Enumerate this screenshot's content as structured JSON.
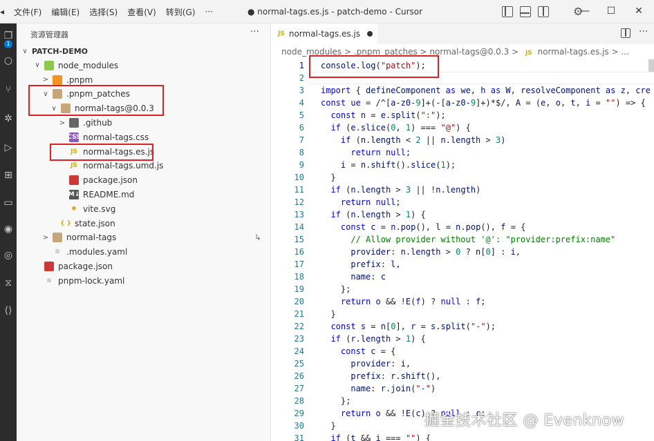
{
  "titlebar": {
    "menu": [
      "文件(F)",
      "编辑(E)",
      "选择(S)",
      "查看(V)",
      "转到(G)",
      "···"
    ],
    "window_title": "● normal-tags.es.js - patch-demo - Cursor",
    "minimize": "—",
    "maximize": "☐",
    "close": "✕"
  },
  "activitybar": {
    "badge": "1",
    "icons": [
      "files-icon",
      "search-icon",
      "source-control-icon",
      "debug-icon",
      "run-icon",
      "extensions-icon",
      "folder-icon",
      "remote-icon",
      "docker-icon",
      "test-icon",
      "bracket-icon"
    ]
  },
  "sidebar": {
    "title": "资源管理器",
    "more": "···",
    "tree": [
      {
        "label": "PATCH-DEMO",
        "chev": "∨",
        "icon": "none",
        "depth": 0,
        "bold": true
      },
      {
        "label": "node_modules",
        "chev": "∨",
        "icon": "folder-node",
        "depth": 1
      },
      {
        "label": ".pnpm",
        "chev": ">",
        "icon": "pnpm",
        "depth": 2
      },
      {
        "label": ".pnpm_patches",
        "chev": "∨",
        "icon": "folder",
        "depth": 2
      },
      {
        "label": "normal-tags@0.0.3",
        "chev": "∨",
        "icon": "folder",
        "depth": 3
      },
      {
        "label": ".github",
        "chev": ">",
        "icon": "folder-gh",
        "depth": 4
      },
      {
        "label": "normal-tags.css",
        "chev": "",
        "icon": "css",
        "depth": 4
      },
      {
        "label": "normal-tags.es.js",
        "chev": "",
        "icon": "js",
        "depth": 4
      },
      {
        "label": "normal-tags.umd.js",
        "chev": "",
        "icon": "js",
        "depth": 4
      },
      {
        "label": "package.json",
        "chev": "",
        "icon": "npm",
        "depth": 4
      },
      {
        "label": "README.md",
        "chev": "",
        "icon": "md",
        "depth": 4
      },
      {
        "label": "vite.svg",
        "chev": "",
        "icon": "svg",
        "depth": 4
      },
      {
        "label": "state.json",
        "chev": "",
        "icon": "json",
        "depth": 3
      },
      {
        "label": "normal-tags",
        "chev": ">",
        "icon": "folder",
        "depth": 2,
        "right": "↳"
      },
      {
        "label": ".modules.yaml",
        "chev": "",
        "icon": "yaml",
        "depth": 2
      },
      {
        "label": "package.json",
        "chev": "",
        "icon": "npm",
        "depth": 1
      },
      {
        "label": "pnpm-lock.yaml",
        "chev": "",
        "icon": "lock",
        "depth": 1
      }
    ]
  },
  "editor": {
    "tab_label": "normal-tags.es.js",
    "tab_icon": "JS",
    "more": "···",
    "breadcrumb": {
      "parts": "node_modules > .pnpm_patches > normal-tags@0.0.3 >",
      "icon": "JS",
      "file": "normal-tags.es.js > ..."
    },
    "lines": [
      "console.log(\"patch\");",
      "",
      "import { defineComponent as we, h as W, resolveComponent as z, cre",
      "const ue = /^[a-z0-9]+(-[a-z0-9]+)*$/, A = (e, o, t, i = \"\") => {",
      "  const n = e.split(\":\");",
      "  if (e.slice(0, 1) === \"@\") {",
      "    if (n.length < 2 || n.length > 3)",
      "      return null;",
      "    i = n.shift().slice(1);",
      "  }",
      "  if (n.length > 3 || !n.length)",
      "    return null;",
      "  if (n.length > 1) {",
      "    const c = n.pop(), l = n.pop(), f = {",
      "      // Allow provider without '@': \"provider:prefix:name\"",
      "      provider: n.length > 0 ? n[0] : i,",
      "      prefix: l,",
      "      name: c",
      "    };",
      "    return o && !E(f) ? null : f;",
      "  }",
      "  const s = n[0], r = s.split(\"-\");",
      "  if (r.length > 1) {",
      "    const c = {",
      "      provider: i,",
      "      prefix: r.shift(),",
      "      name: r.join(\"-\")",
      "    };",
      "    return o && !E(c) ? null : c;",
      "  }",
      "  if (t && i === \"\") {"
    ]
  },
  "watermark": "掘金技术社区 @ Evenknow",
  "colors": {
    "keyword": "#0000ff",
    "string": "#a31515",
    "comment": "#008000",
    "variable": "#001080",
    "number": "#098658",
    "highlight_box": "#e02020"
  }
}
